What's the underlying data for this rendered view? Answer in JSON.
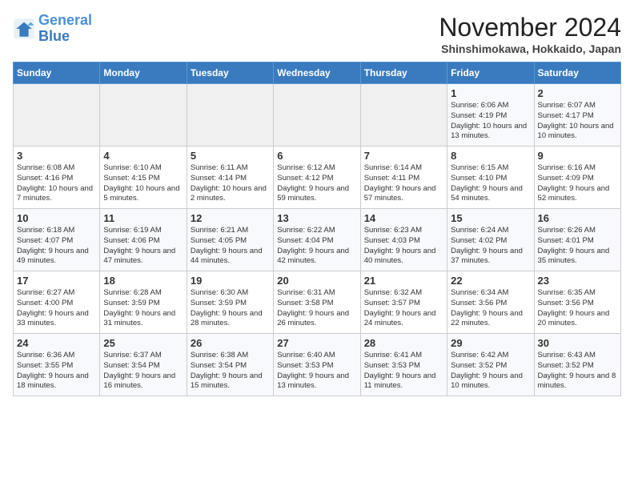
{
  "logo": {
    "line1": "General",
    "line2": "Blue"
  },
  "title": "November 2024",
  "location": "Shinshimokawa, Hokkaido, Japan",
  "days_of_week": [
    "Sunday",
    "Monday",
    "Tuesday",
    "Wednesday",
    "Thursday",
    "Friday",
    "Saturday"
  ],
  "weeks": [
    [
      {
        "day": "",
        "info": ""
      },
      {
        "day": "",
        "info": ""
      },
      {
        "day": "",
        "info": ""
      },
      {
        "day": "",
        "info": ""
      },
      {
        "day": "",
        "info": ""
      },
      {
        "day": "1",
        "info": "Sunrise: 6:06 AM\nSunset: 4:19 PM\nDaylight: 10 hours\nand 13 minutes."
      },
      {
        "day": "2",
        "info": "Sunrise: 6:07 AM\nSunset: 4:17 PM\nDaylight: 10 hours\nand 10 minutes."
      }
    ],
    [
      {
        "day": "3",
        "info": "Sunrise: 6:08 AM\nSunset: 4:16 PM\nDaylight: 10 hours\nand 7 minutes."
      },
      {
        "day": "4",
        "info": "Sunrise: 6:10 AM\nSunset: 4:15 PM\nDaylight: 10 hours\nand 5 minutes."
      },
      {
        "day": "5",
        "info": "Sunrise: 6:11 AM\nSunset: 4:14 PM\nDaylight: 10 hours\nand 2 minutes."
      },
      {
        "day": "6",
        "info": "Sunrise: 6:12 AM\nSunset: 4:12 PM\nDaylight: 9 hours\nand 59 minutes."
      },
      {
        "day": "7",
        "info": "Sunrise: 6:14 AM\nSunset: 4:11 PM\nDaylight: 9 hours\nand 57 minutes."
      },
      {
        "day": "8",
        "info": "Sunrise: 6:15 AM\nSunset: 4:10 PM\nDaylight: 9 hours\nand 54 minutes."
      },
      {
        "day": "9",
        "info": "Sunrise: 6:16 AM\nSunset: 4:09 PM\nDaylight: 9 hours\nand 52 minutes."
      }
    ],
    [
      {
        "day": "10",
        "info": "Sunrise: 6:18 AM\nSunset: 4:07 PM\nDaylight: 9 hours\nand 49 minutes."
      },
      {
        "day": "11",
        "info": "Sunrise: 6:19 AM\nSunset: 4:06 PM\nDaylight: 9 hours\nand 47 minutes."
      },
      {
        "day": "12",
        "info": "Sunrise: 6:21 AM\nSunset: 4:05 PM\nDaylight: 9 hours\nand 44 minutes."
      },
      {
        "day": "13",
        "info": "Sunrise: 6:22 AM\nSunset: 4:04 PM\nDaylight: 9 hours\nand 42 minutes."
      },
      {
        "day": "14",
        "info": "Sunrise: 6:23 AM\nSunset: 4:03 PM\nDaylight: 9 hours\nand 40 minutes."
      },
      {
        "day": "15",
        "info": "Sunrise: 6:24 AM\nSunset: 4:02 PM\nDaylight: 9 hours\nand 37 minutes."
      },
      {
        "day": "16",
        "info": "Sunrise: 6:26 AM\nSunset: 4:01 PM\nDaylight: 9 hours\nand 35 minutes."
      }
    ],
    [
      {
        "day": "17",
        "info": "Sunrise: 6:27 AM\nSunset: 4:00 PM\nDaylight: 9 hours\nand 33 minutes."
      },
      {
        "day": "18",
        "info": "Sunrise: 6:28 AM\nSunset: 3:59 PM\nDaylight: 9 hours\nand 31 minutes."
      },
      {
        "day": "19",
        "info": "Sunrise: 6:30 AM\nSunset: 3:59 PM\nDaylight: 9 hours\nand 28 minutes."
      },
      {
        "day": "20",
        "info": "Sunrise: 6:31 AM\nSunset: 3:58 PM\nDaylight: 9 hours\nand 26 minutes."
      },
      {
        "day": "21",
        "info": "Sunrise: 6:32 AM\nSunset: 3:57 PM\nDaylight: 9 hours\nand 24 minutes."
      },
      {
        "day": "22",
        "info": "Sunrise: 6:34 AM\nSunset: 3:56 PM\nDaylight: 9 hours\nand 22 minutes."
      },
      {
        "day": "23",
        "info": "Sunrise: 6:35 AM\nSunset: 3:56 PM\nDaylight: 9 hours\nand 20 minutes."
      }
    ],
    [
      {
        "day": "24",
        "info": "Sunrise: 6:36 AM\nSunset: 3:55 PM\nDaylight: 9 hours\nand 18 minutes."
      },
      {
        "day": "25",
        "info": "Sunrise: 6:37 AM\nSunset: 3:54 PM\nDaylight: 9 hours\nand 16 minutes."
      },
      {
        "day": "26",
        "info": "Sunrise: 6:38 AM\nSunset: 3:54 PM\nDaylight: 9 hours\nand 15 minutes."
      },
      {
        "day": "27",
        "info": "Sunrise: 6:40 AM\nSunset: 3:53 PM\nDaylight: 9 hours\nand 13 minutes."
      },
      {
        "day": "28",
        "info": "Sunrise: 6:41 AM\nSunset: 3:53 PM\nDaylight: 9 hours\nand 11 minutes."
      },
      {
        "day": "29",
        "info": "Sunrise: 6:42 AM\nSunset: 3:52 PM\nDaylight: 9 hours\nand 10 minutes."
      },
      {
        "day": "30",
        "info": "Sunrise: 6:43 AM\nSunset: 3:52 PM\nDaylight: 9 hours\nand 8 minutes."
      }
    ]
  ]
}
